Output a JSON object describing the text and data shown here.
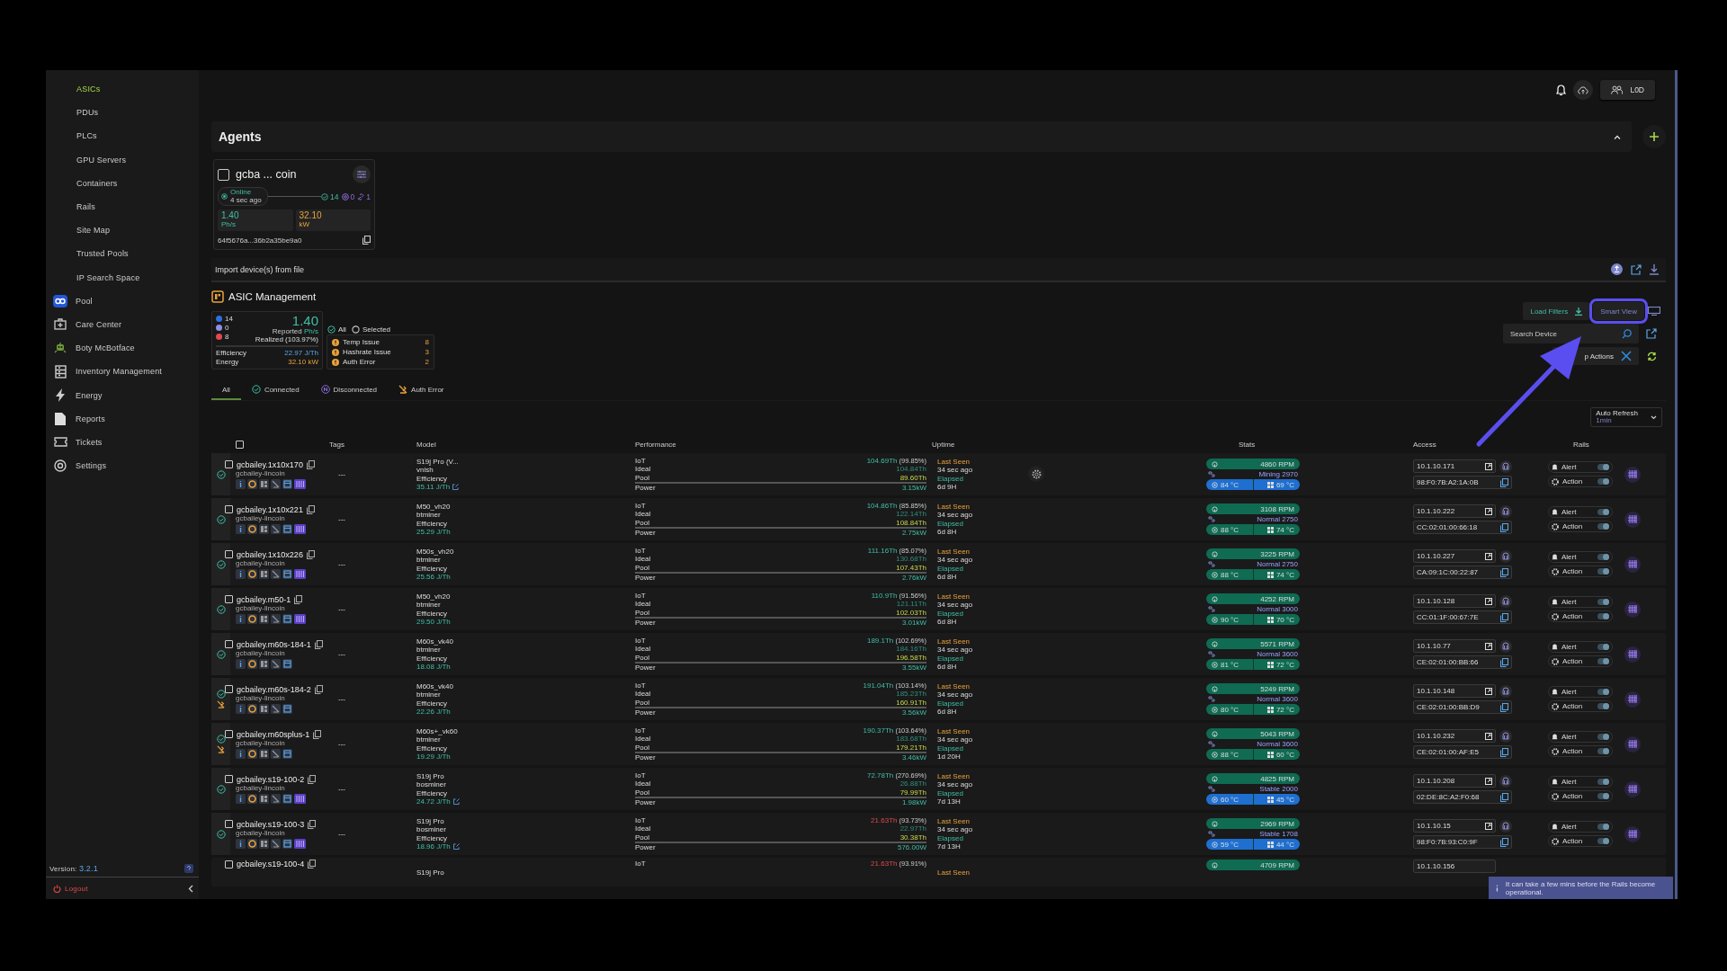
{
  "sidebar": {
    "items": [
      {
        "label": "ASICs",
        "kind": "sub",
        "selected": true
      },
      {
        "label": "PDUs",
        "kind": "sub",
        "selected": false
      },
      {
        "label": "PLCs",
        "kind": "sub",
        "selected": false
      },
      {
        "label": "GPU Servers",
        "kind": "sub",
        "selected": false
      },
      {
        "label": "Containers",
        "kind": "sub",
        "selected": false
      },
      {
        "label": "Rails",
        "kind": "sub",
        "selected": false
      },
      {
        "label": "Site Map",
        "kind": "sub",
        "selected": false
      },
      {
        "label": "Trusted Pools",
        "kind": "sub",
        "selected": false
      },
      {
        "label": "IP Search Space",
        "kind": "sub",
        "selected": false
      },
      {
        "label": "Pool",
        "kind": "pool",
        "selected": false
      },
      {
        "label": "Care Center",
        "kind": "care",
        "selected": false
      },
      {
        "label": "Boty McBotface",
        "kind": "bot",
        "selected": false
      },
      {
        "label": "Inventory Management",
        "kind": "inventory",
        "selected": false
      },
      {
        "label": "Energy",
        "kind": "energy",
        "selected": false
      },
      {
        "label": "Reports",
        "kind": "reports",
        "selected": false
      },
      {
        "label": "Tickets",
        "kind": "tickets",
        "selected": false
      },
      {
        "label": "Settings",
        "kind": "settings",
        "selected": false
      }
    ],
    "version_label": "Version:",
    "version": "3.2.1",
    "logout": "Logout"
  },
  "top_bar": {
    "user": "L0D"
  },
  "agents": {
    "title": "Agents",
    "card": {
      "checked": false,
      "name": "gcba ... coin",
      "status": "Online",
      "last_seen": "4 sec ago",
      "connected": "14",
      "disconnected": "0",
      "links": "1",
      "hashrate": "1.40",
      "hashrate_unit": "Ph/s",
      "power": "32.10",
      "power_unit": "kW",
      "id": "64f5676a...36b2a35be9a0"
    }
  },
  "import": {
    "label": "Import device(s) from file"
  },
  "asic": {
    "title": "ASIC Management",
    "summary": {
      "connected": "14",
      "disconnected": "0",
      "errors": "8",
      "hashrate": "1.40",
      "reported": "Reported",
      "unit": "Ph/s",
      "realized": "Realized",
      "realized_pct": "(103.97%)",
      "efficiency_label": "Efficiency",
      "efficiency": "22.97 J/Th",
      "energy_label": "Energy",
      "energy": "32.10 kW"
    },
    "scope": [
      {
        "label": "All",
        "selected": true
      },
      {
        "label": "Selected",
        "selected": false
      }
    ],
    "issues": [
      {
        "label": "Temp Issue",
        "count": "8"
      },
      {
        "label": "Hashrate Issue",
        "count": "3"
      },
      {
        "label": "Auth Error",
        "count": "2"
      }
    ],
    "tabs": [
      {
        "label": "All",
        "kind": "all",
        "selected": true
      },
      {
        "label": "Connected",
        "kind": "connected",
        "selected": false
      },
      {
        "label": "Disconnected",
        "kind": "disconnected",
        "selected": false
      },
      {
        "label": "Auth Error",
        "kind": "auth",
        "selected": false
      }
    ],
    "load_filters": "Load Filters",
    "smart_view": "Smart View",
    "search": {
      "placeholder": "Search Device"
    },
    "actions": "p Actions",
    "auto_refresh": {
      "label": "Auto Refresh",
      "value": "1min"
    }
  },
  "table": {
    "select_all_checked": false,
    "columns": [
      "Tags",
      "Model",
      "Performance",
      "Uptime",
      "Stats",
      "Access",
      "Rails"
    ],
    "rows": [
      {
        "kind": "full",
        "connected": true,
        "auth_error": false,
        "checked": false,
        "name": "gcbailey.1x10x170",
        "group": "gcbailey-lincoin",
        "hashboard_icon": true,
        "tags": "---",
        "model": "S19j Pro (V...",
        "firmware": "vnish",
        "efficiency_label": "Efficiency",
        "efficiency": "35.11 J/Th",
        "edit_link": true,
        "iot_label": "IoT",
        "iot": "104.69Th",
        "iot_pct": "(99.85%)",
        "iot_warning": false,
        "ideal_label": "Ideal",
        "ideal": "104.84Th",
        "pool_label": "Pool",
        "pool": "89.60Th",
        "power_label": "Power",
        "power": "3.15kW",
        "last_seen": "Last Seen",
        "seen_ago": "34 sec ago",
        "elapsed_label": "Elapsed",
        "elapsed": "6d 9H",
        "rpm": "4860 RPM",
        "mode": "Mining 2970",
        "chip_temp": "84 °C",
        "board_temp": "69 °C",
        "temp_highlight": true,
        "ip": "10.1.10.171",
        "mac": "98:F0:7B:A2:1A:0B",
        "alert_label": "Alert",
        "alert_on": true,
        "action_label": "Action",
        "action_on": true
      },
      {
        "kind": "full",
        "connected": true,
        "auth_error": false,
        "checked": false,
        "name": "gcbailey.1x10x221",
        "group": "gcbailey-lincoin",
        "hashboard_icon": true,
        "tags": "---",
        "model": "M50_vh20",
        "firmware": "btminer",
        "efficiency_label": "Efficiency",
        "efficiency": "25.29 J/Th",
        "edit_link": false,
        "iot_label": "IoT",
        "iot": "104.86Th",
        "iot_pct": "(85.85%)",
        "iot_warning": false,
        "ideal_label": "Ideal",
        "ideal": "122.14Th",
        "pool_label": "Pool",
        "pool": "108.84Th",
        "power_label": "Power",
        "power": "2.75kW",
        "last_seen": "Last Seen",
        "seen_ago": "34 sec ago",
        "elapsed_label": "Elapsed",
        "elapsed": "6d 8H",
        "rpm": "3108 RPM",
        "mode": "Normal 2750",
        "chip_temp": "88 °C",
        "board_temp": "74 °C",
        "temp_highlight": false,
        "ip": "10.1.10.222",
        "mac": "CC:02:01:00:66:18",
        "alert_label": "Alert",
        "alert_on": true,
        "action_label": "Action",
        "action_on": true
      },
      {
        "kind": "full",
        "connected": true,
        "auth_error": false,
        "checked": false,
        "name": "gcbailey.1x10x226",
        "group": "gcbailey-lincoin",
        "hashboard_icon": true,
        "tags": "---",
        "model": "M50s_vh20",
        "firmware": "btminer",
        "efficiency_label": "Efficiency",
        "efficiency": "25.56 J/Th",
        "edit_link": false,
        "iot_label": "IoT",
        "iot": "111.16Th",
        "iot_pct": "(85.07%)",
        "iot_warning": false,
        "ideal_label": "Ideal",
        "ideal": "130.68Th",
        "pool_label": "Pool",
        "pool": "107.43Th",
        "power_label": "Power",
        "power": "2.76kW",
        "last_seen": "Last Seen",
        "seen_ago": "34 sec ago",
        "elapsed_label": "Elapsed",
        "elapsed": "6d 8H",
        "rpm": "3225 RPM",
        "mode": "Normal 2750",
        "chip_temp": "88 °C",
        "board_temp": "74 °C",
        "temp_highlight": false,
        "ip": "10.1.10.227",
        "mac": "CA:09:1C:00:22:87",
        "alert_label": "Alert",
        "alert_on": true,
        "action_label": "Action",
        "action_on": true
      },
      {
        "kind": "full",
        "connected": true,
        "auth_error": false,
        "checked": false,
        "name": "gcbailey.m50-1",
        "group": "gcbailey-lincoin",
        "hashboard_icon": true,
        "tags": "---",
        "model": "M50_vh20",
        "firmware": "btminer",
        "efficiency_label": "Efficiency",
        "efficiency": "29.50 J/Th",
        "edit_link": false,
        "iot_label": "IoT",
        "iot": "110.9Th",
        "iot_pct": "(91.56%)",
        "iot_warning": false,
        "ideal_label": "Ideal",
        "ideal": "121.11Th",
        "pool_label": "Pool",
        "pool": "102.03Th",
        "power_label": "Power",
        "power": "3.01kW",
        "last_seen": "Last Seen",
        "seen_ago": "34 sec ago",
        "elapsed_label": "Elapsed",
        "elapsed": "6d 8H",
        "rpm": "4252 RPM",
        "mode": "Normal 3000",
        "chip_temp": "90 °C",
        "board_temp": "70 °C",
        "temp_highlight": false,
        "ip": "10.1.10.128",
        "mac": "CC:01:1F:00:67:7E",
        "alert_label": "Alert",
        "alert_on": true,
        "action_label": "Action",
        "action_on": true
      },
      {
        "kind": "full",
        "connected": true,
        "auth_error": false,
        "checked": false,
        "name": "gcbailey.m60s-184-1",
        "group": "gcbailey-lincoin",
        "hashboard_icon": false,
        "tags": "---",
        "model": "M60s_vk40",
        "firmware": "btminer",
        "efficiency_label": "Efficiency",
        "efficiency": "18.08 J/Th",
        "edit_link": false,
        "iot_label": "IoT",
        "iot": "189.1Th",
        "iot_pct": "(102.69%)",
        "iot_warning": false,
        "ideal_label": "Ideal",
        "ideal": "184.16Th",
        "pool_label": "Pool",
        "pool": "196.58Th",
        "power_label": "Power",
        "power": "3.55kW",
        "last_seen": "Last Seen",
        "seen_ago": "34 sec ago",
        "elapsed_label": "Elapsed",
        "elapsed": "6d 8H",
        "rpm": "5571 RPM",
        "mode": "Normal 3600",
        "chip_temp": "81 °C",
        "board_temp": "72 °C",
        "temp_highlight": false,
        "ip": "10.1.10.77",
        "mac": "CE:02:01:00:BB:66",
        "alert_label": "Alert",
        "alert_on": true,
        "action_label": "Action",
        "action_on": true
      },
      {
        "kind": "full",
        "connected": true,
        "auth_error": true,
        "checked": false,
        "name": "gcbailey.m60s-184-2",
        "group": "gcbailey-lincoin",
        "hashboard_icon": false,
        "tags": "---",
        "model": "M60s_vk40",
        "firmware": "btminer",
        "efficiency_label": "Efficiency",
        "efficiency": "22.26 J/Th",
        "edit_link": false,
        "iot_label": "IoT",
        "iot": "191.04Th",
        "iot_pct": "(103.14%)",
        "iot_warning": false,
        "ideal_label": "Ideal",
        "ideal": "185.23Th",
        "pool_label": "Pool",
        "pool": "160.91Th",
        "power_label": "Power",
        "power": "3.56kW",
        "last_seen": "Last Seen",
        "seen_ago": "34 sec ago",
        "elapsed_label": "Elapsed",
        "elapsed": "6d 8H",
        "rpm": "5249 RPM",
        "mode": "Normal 3600",
        "chip_temp": "80 °C",
        "board_temp": "72 °C",
        "temp_highlight": false,
        "ip": "10.1.10.148",
        "mac": "CE:02:01:00:BB:D9",
        "alert_label": "Alert",
        "alert_on": true,
        "action_label": "Action",
        "action_on": true
      },
      {
        "kind": "full",
        "connected": true,
        "auth_error": true,
        "checked": false,
        "name": "gcbailey.m60splus-1",
        "group": "gcbailey-lincoin",
        "hashboard_icon": false,
        "tags": "---",
        "model": "M60s+_vk60",
        "firmware": "btminer",
        "efficiency_label": "Efficiency",
        "efficiency": "19.29 J/Th",
        "edit_link": false,
        "iot_label": "IoT",
        "iot": "190.37Th",
        "iot_pct": "(103.64%)",
        "iot_warning": false,
        "ideal_label": "Ideal",
        "ideal": "183.68Th",
        "pool_label": "Pool",
        "pool": "179.21Th",
        "power_label": "Power",
        "power": "3.46kW",
        "last_seen": "Last Seen",
        "seen_ago": "34 sec ago",
        "elapsed_label": "Elapsed",
        "elapsed": "1d 20H",
        "rpm": "5043 RPM",
        "mode": "Normal 3600",
        "chip_temp": "88 °C",
        "board_temp": "60 °C",
        "temp_highlight": false,
        "ip": "10.1.10.232",
        "mac": "CE:02:01:00:AF:E5",
        "alert_label": "Alert",
        "alert_on": true,
        "action_label": "Action",
        "action_on": true
      },
      {
        "kind": "full",
        "connected": true,
        "auth_error": false,
        "checked": false,
        "name": "gcbailey.s19-100-2",
        "group": "gcbailey-lincoin",
        "hashboard_icon": true,
        "tags": "---",
        "model": "S19j Pro",
        "firmware": "bosminer",
        "efficiency_label": "Efficiency",
        "efficiency": "24.72 J/Th",
        "edit_link": true,
        "iot_label": "IoT",
        "iot": "72.78Th",
        "iot_pct": "(270.69%)",
        "iot_warning": false,
        "ideal_label": "Ideal",
        "ideal": "26.88Th",
        "pool_label": "Pool",
        "pool": "79.99Th",
        "power_label": "Power",
        "power": "1.98kW",
        "last_seen": "Last Seen",
        "seen_ago": "34 sec ago",
        "elapsed_label": "Elapsed",
        "elapsed": "7d 13H",
        "rpm": "4825 RPM",
        "mode": "Stable 2000",
        "chip_temp": "60 °C",
        "board_temp": "45 °C",
        "temp_highlight": true,
        "ip": "10.1.10.208",
        "mac": "02:DE:8C:A2:F0:68",
        "alert_label": "Alert",
        "alert_on": true,
        "action_label": "Action",
        "action_on": true
      },
      {
        "kind": "full",
        "connected": true,
        "auth_error": false,
        "checked": false,
        "name": "gcbailey.s19-100-3",
        "group": "gcbailey-lincoin",
        "hashboard_icon": true,
        "tags": "---",
        "model": "S19j Pro",
        "firmware": "bosminer",
        "efficiency_label": "Efficiency",
        "efficiency": "18.96 J/Th",
        "edit_link": true,
        "iot_label": "IoT",
        "iot": "21.63Th",
        "iot_pct": "(93.73%)",
        "iot_warning": true,
        "ideal_label": "Ideal",
        "ideal": "22.97Th",
        "pool_label": "Pool",
        "pool": "30.38Th",
        "power_label": "Power",
        "power": "576.00W",
        "last_seen": "Last Seen",
        "seen_ago": "34 sec ago",
        "elapsed_label": "Elapsed",
        "elapsed": "7d 13H",
        "rpm": "2969 RPM",
        "mode": "Stable 1708",
        "chip_temp": "59 °C",
        "board_temp": "44 °C",
        "temp_highlight": true,
        "ip": "10.1.10.15",
        "mac": "98:F0:7B:93:C0:9F",
        "alert_label": "Alert",
        "alert_on": true,
        "action_label": "Action",
        "action_on": true
      },
      {
        "kind": "partial",
        "checked": false,
        "name": "gcbailey.s19-100-4",
        "model": "S19j Pro",
        "iot_label": "IoT",
        "iot": "21.63Th",
        "iot_pct": "(93.91%)",
        "iot_warning": true,
        "last_seen": "Last Seen",
        "rpm": "4709 RPM",
        "ip": "10.1.10.156"
      }
    ]
  },
  "toast": {
    "text": "It can take a few mins before the Rails become operational."
  }
}
